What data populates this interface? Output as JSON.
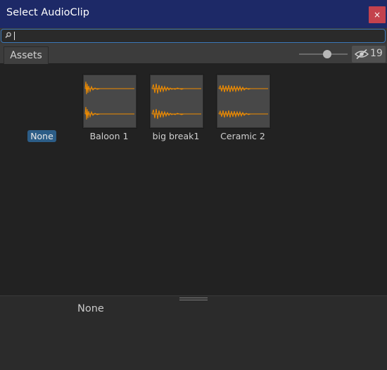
{
  "window": {
    "title": "Select AudioClip",
    "close_label": "×"
  },
  "search": {
    "value": "",
    "placeholder": ""
  },
  "tabs": [
    {
      "label": "Assets",
      "selected": true
    }
  ],
  "toolbar": {
    "hidden_count": "19",
    "zoom_slider": 0.6
  },
  "items": [
    {
      "label": "None",
      "selected": true
    },
    {
      "label": "Baloon 1",
      "icon": "audio-waveform-icon"
    },
    {
      "label": "big break1",
      "icon": "audio-waveform-icon"
    },
    {
      "label": "Ceramic 2",
      "icon": "audio-waveform-icon"
    }
  ],
  "preview": {
    "label": "None"
  },
  "colors": {
    "titlebar": "#1d2967",
    "close": "#c4424d",
    "accent": "#3d78b9",
    "selection": "#2c5d87",
    "waveform": "#f08c00"
  }
}
